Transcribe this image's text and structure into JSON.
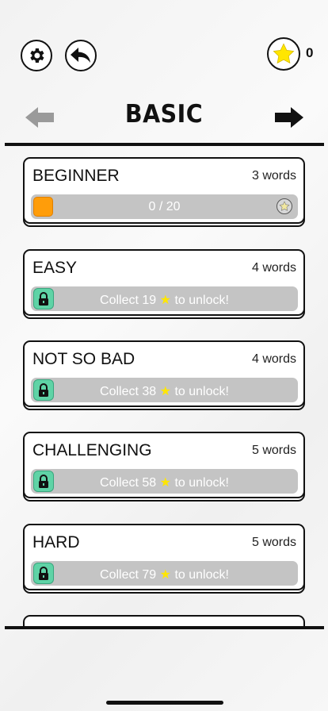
{
  "header": {
    "settings_icon": "gear-icon",
    "back_icon": "back-arrow-icon",
    "star_icon": "star-icon",
    "star_count": "0"
  },
  "pack": {
    "title": "BASIC",
    "prev_icon": "left-arrow-icon",
    "next_icon": "right-arrow-icon"
  },
  "levels": [
    {
      "name": "BEGINNER",
      "words": "3 words",
      "status": "0 / 20",
      "progress": 0.0,
      "locked": false
    },
    {
      "name": "EASY",
      "words": "4 words",
      "status_prefix": "Collect 19",
      "status_suffix": "to unlock!",
      "locked": true
    },
    {
      "name": "NOT SO BAD",
      "words": "4 words",
      "status_prefix": "Collect 38",
      "status_suffix": "to unlock!",
      "locked": true
    },
    {
      "name": "CHALLENGING",
      "words": "5 words",
      "status_prefix": "Collect 58",
      "status_suffix": "to unlock!",
      "locked": true
    },
    {
      "name": "HARD",
      "words": "5 words",
      "status_prefix": "Collect 79",
      "status_suffix": "to unlock!",
      "locked": true
    }
  ],
  "colors": {
    "progress_fill": "#ff9d0a",
    "lock_badge": "#5fd3a6",
    "bar": "#c4c4c4",
    "star": "#ffe600"
  }
}
